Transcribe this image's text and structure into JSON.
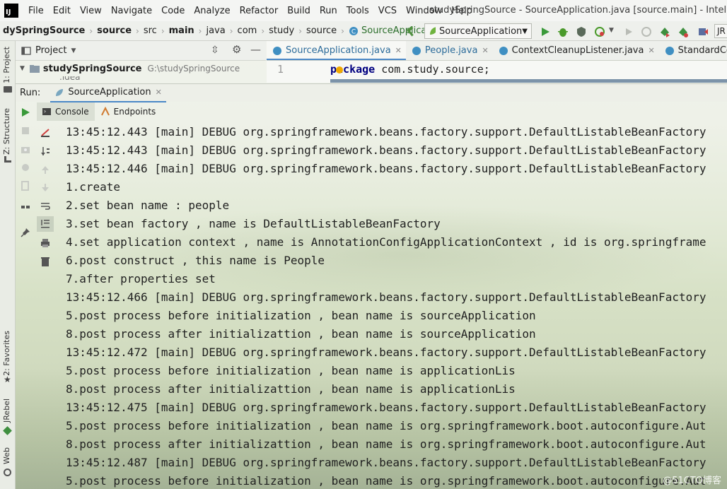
{
  "window": {
    "title": "studySpringSource - SourceApplication.java [source.main] - IntelliJ",
    "logo_text": "IJ"
  },
  "menu": [
    "File",
    "Edit",
    "View",
    "Navigate",
    "Code",
    "Analyze",
    "Refactor",
    "Build",
    "Run",
    "Tools",
    "VCS",
    "Window",
    "Help"
  ],
  "breadcrumb": [
    "dySpringSource",
    "source",
    "src",
    "main",
    "java",
    "com",
    "study",
    "source",
    "SourceApplication"
  ],
  "run_config": {
    "label": "SourceApplication"
  },
  "toolbar_right_label": "JR",
  "left_strip": {
    "tabs": [
      "1: Project",
      "Z: Structure",
      "2: Favorites",
      "JRebel",
      "Web"
    ]
  },
  "project_pane": {
    "title": "Project",
    "root_name": "studySpringSource",
    "root_path": "G:\\studySpringSource",
    "child": ".idea"
  },
  "editor": {
    "tabs": [
      {
        "label": "SourceApplication.java",
        "active": true
      },
      {
        "label": "People.java",
        "active": false
      },
      {
        "label": "ContextCleanupListener.java",
        "active": false
      },
      {
        "label": "StandardContext.java",
        "active": false
      }
    ],
    "line_number": "1",
    "code": {
      "keyword": "package",
      "rest": " com.study.source;"
    }
  },
  "run_window": {
    "label": "Run:",
    "tab": "SourceApplication",
    "subtabs": [
      "Console",
      "Endpoints"
    ]
  },
  "console_lines": [
    "13:45:12.443 [main] DEBUG org.springframework.beans.factory.support.DefaultListableBeanFactory",
    "13:45:12.443 [main] DEBUG org.springframework.beans.factory.support.DefaultListableBeanFactory",
    "13:45:12.446 [main] DEBUG org.springframework.beans.factory.support.DefaultListableBeanFactory",
    "1.create",
    "2.set bean name : people",
    "3.set bean factory , name is DefaultListableBeanFactory",
    "4.set application context , name is AnnotationConfigApplicationContext , id is org.springframe",
    "6.post construct , this name is People",
    "7.after properties set",
    "13:45:12.466 [main] DEBUG org.springframework.beans.factory.support.DefaultListableBeanFactory",
    "5.post process before initialization , bean name is sourceApplication",
    "8.post process after initializattion , bean name is sourceApplication",
    "13:45:12.472 [main] DEBUG org.springframework.beans.factory.support.DefaultListableBeanFactory",
    "5.post process before initialization , bean name is applicationLis",
    "8.post process after initializattion , bean name is applicationLis",
    "13:45:12.475 [main] DEBUG org.springframework.beans.factory.support.DefaultListableBeanFactory",
    "5.post process before initialization , bean name is org.springframework.boot.autoconfigure.Aut",
    "8.post process after initializattion , bean name is org.springframework.boot.autoconfigure.Aut",
    "13:45:12.487 [main] DEBUG org.springframework.beans.factory.support.DefaultListableBeanFactory",
    "5.post process before initialization , bean name is org.springframework.boot.autoconfigure.Aut"
  ],
  "watermark": "@51CTO博客",
  "colors": {
    "run_green": "#3a9a3a",
    "debug_green": "#4a9a2a",
    "keyword": "#000080",
    "tab_underline": "#4a88c7"
  }
}
